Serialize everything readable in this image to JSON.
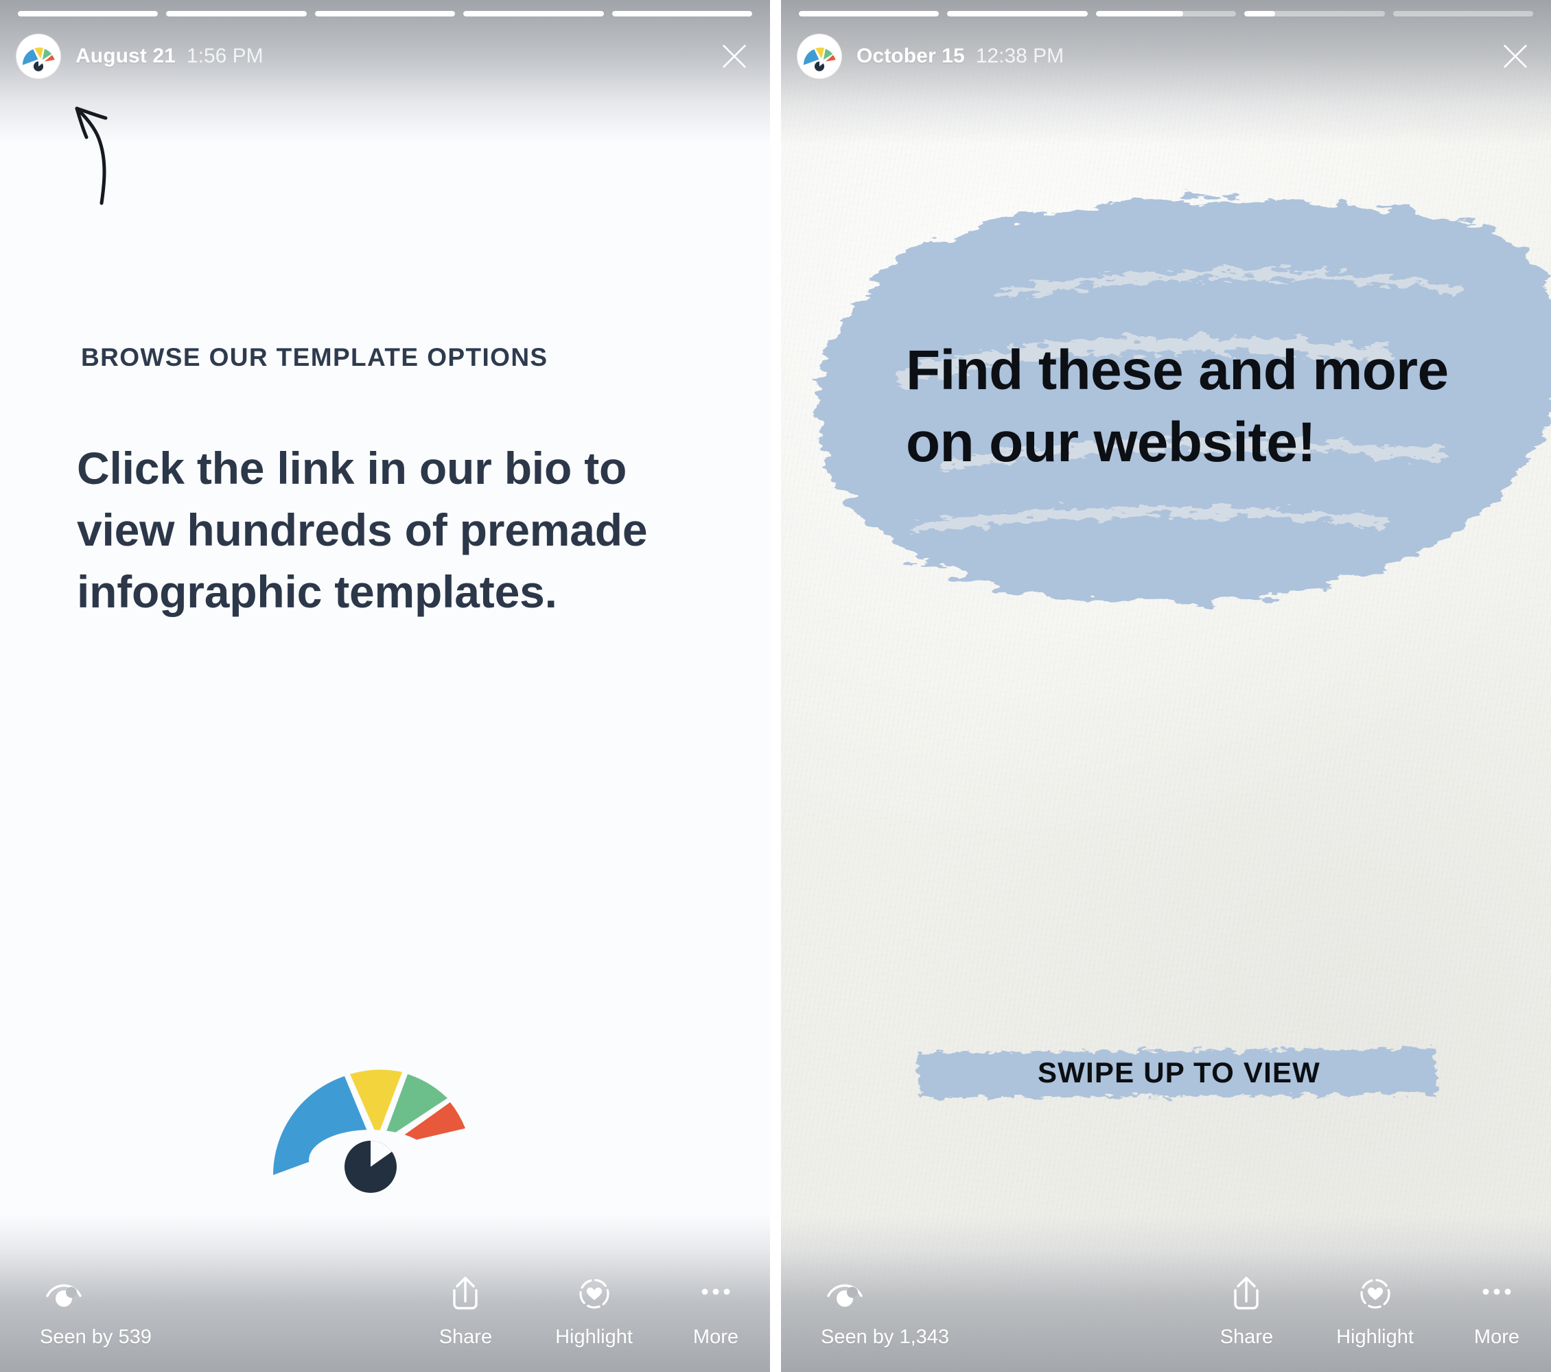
{
  "stories": [
    {
      "id": "story-left",
      "progress": {
        "segments": 5,
        "filled_index": 0,
        "partial_fraction": 1.0,
        "fills": [
          1,
          1,
          1,
          1,
          1
        ]
      },
      "header": {
        "avatar_icon": "gauge-logo-avatar",
        "date": "August 21",
        "time": "1:56 PM",
        "close_icon": "close-icon"
      },
      "annotation": {
        "icon": "hand-drawn-curved-arrow",
        "points_to": "avatar"
      },
      "content": {
        "eyebrow": "BROWSE OUR TEMPLATE OPTIONS",
        "headline": "Click the link in our bio to view hundreds of premade infographic templates.",
        "logo_icon": "gauge-chart-logo"
      },
      "toolbar": {
        "seen_icon": "eye-icon",
        "seen_label": "Seen by 539",
        "share_icon": "share-upload-icon",
        "share_label": "Share",
        "highlight_icon": "heart-in-dashed-circle-icon",
        "highlight_label": "Highlight",
        "more_icon": "ellipsis-icon",
        "more_label": "More"
      }
    },
    {
      "id": "story-right",
      "progress": {
        "segments": 5,
        "filled_index": 2,
        "partial_fraction": 0.62,
        "fills": [
          1,
          1,
          0.62,
          0.22,
          0
        ]
      },
      "header": {
        "avatar_icon": "gauge-logo-avatar",
        "date": "October 15",
        "time": "12:38 PM",
        "close_icon": "close-icon"
      },
      "content": {
        "headline": "Find these and more on our website!",
        "logo_icon": "gauge-chart-logo",
        "cta_label": "SWIPE UP TO VIEW",
        "cta_brush_icon": "brush-stroke-underline"
      },
      "toolbar": {
        "seen_icon": "eye-icon",
        "seen_label": "Seen by 1,343",
        "share_icon": "share-upload-icon",
        "share_label": "Share",
        "highlight_icon": "heart-in-dashed-circle-icon",
        "highlight_label": "Highlight",
        "more_icon": "ellipsis-icon",
        "more_label": "More"
      }
    }
  ],
  "colors": {
    "brand_blue": "#3f9bd4",
    "brand_yellow": "#f3d43c",
    "brand_green": "#6cbf8b",
    "brand_red": "#e8583a",
    "brand_navy": "#22303f",
    "brush_blue": "#adc2db",
    "text_dark": "#2c3849",
    "text_black": "#0c0f14",
    "chrome_white": "#ffffff",
    "paper_bg": "#f2f2ee"
  }
}
